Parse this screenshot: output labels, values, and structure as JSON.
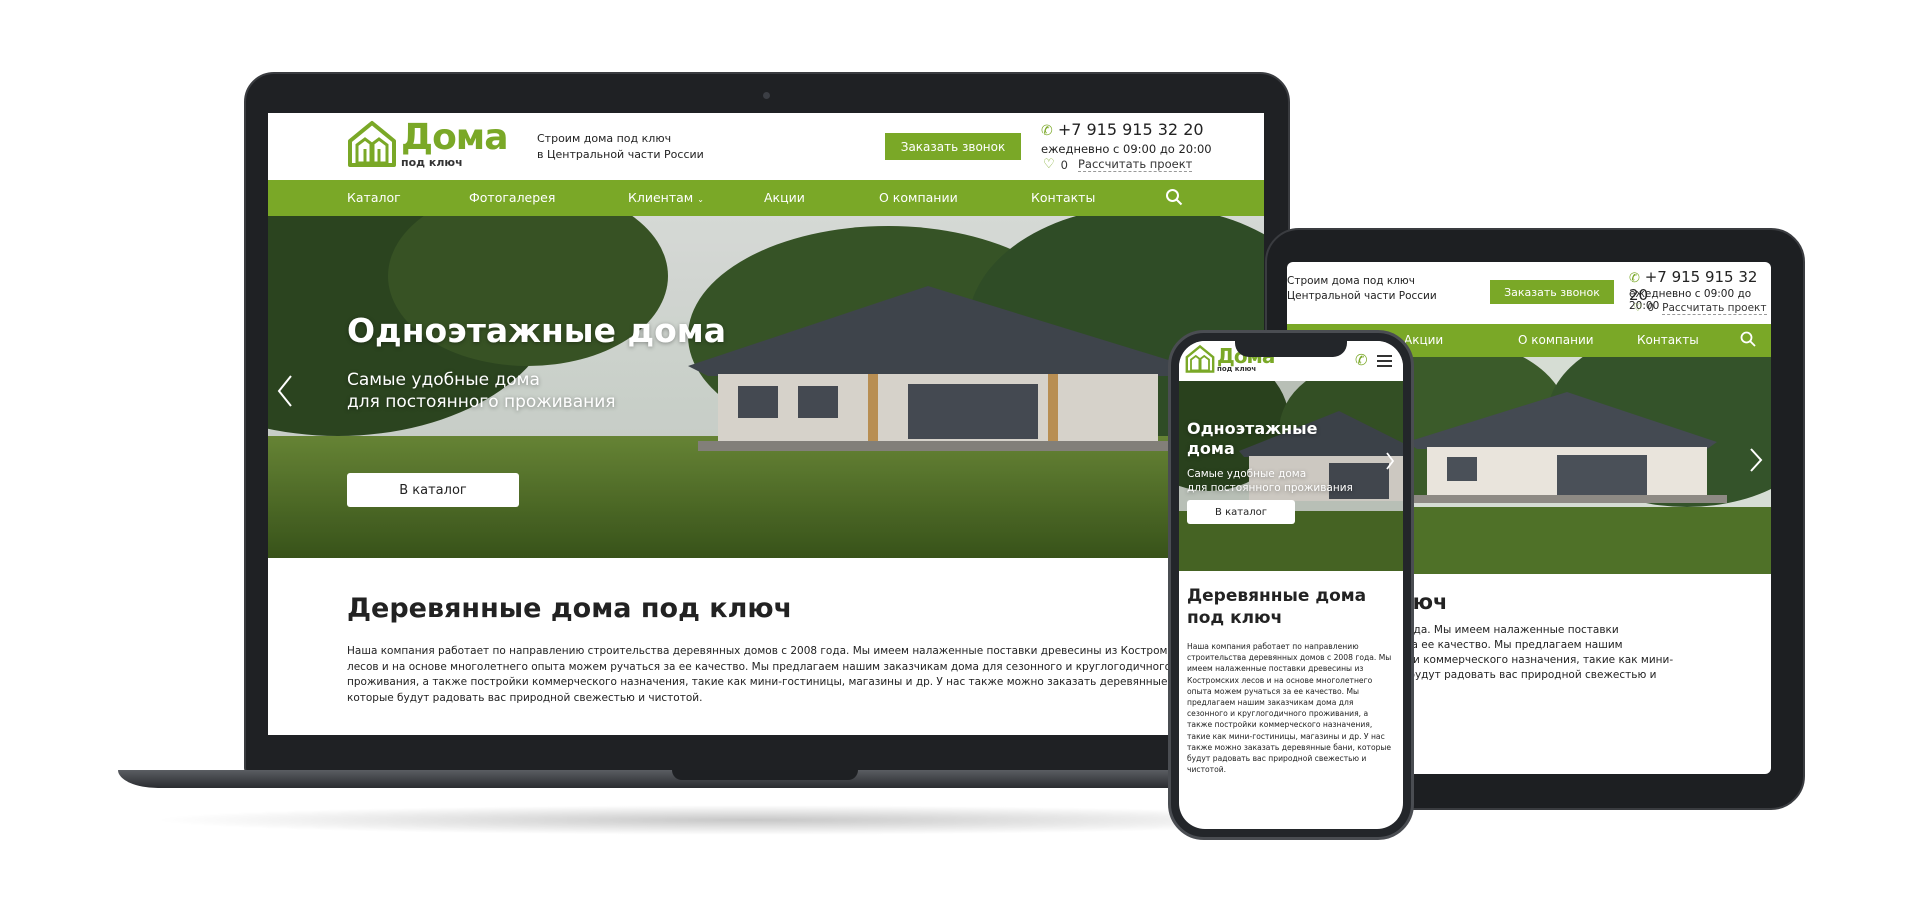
{
  "brand": {
    "logo_word": "Дома",
    "logo_sub": "под ключ",
    "tagline_line1": "Строим дома под ключ",
    "tagline_line2": "в Центральной части России"
  },
  "header": {
    "call_button": "Заказать звонок",
    "phone": "+7 915 915 32 20",
    "hours": "ежедневно с 09:00 до 20:00",
    "wishlist_count": "0",
    "calc_link": "Рассчитать проект"
  },
  "nav": {
    "items": [
      "Каталог",
      "Фотогалерея",
      "Клиентам",
      "Акции",
      "О компании",
      "Контакты"
    ]
  },
  "hero": {
    "title": "Одноэтажные дома",
    "subtitle_line1": "Самые удобные дома",
    "subtitle_line2": "для постоянного проживания",
    "button": "В каталог"
  },
  "about": {
    "title": "Деревянные дома под ключ",
    "text": "Наша компания работает по направлению строительства деревянных домов с 2008 года. Мы имеем налаженные поставки древесины из Костромских лесов и на основе многолетнего опыта можем ручаться за ее качество. Мы предлагаем нашим заказчикам дома для сезонного и круглогодичного проживания, а также постройки коммерческого назначения, такие как мини-гостиницы, магазины и др. У нас также можно заказать деревянные бани, которые будут радовать вас природной свежестью и чистотой.",
    "laptop_lines": [
      "Наша компания работает по направлению строительства деревянных домов с 2008 года. Мы имеем налаженные поставки древесины из Костромских",
      "лесов и на основе многолетнего опыта можем ручаться за ее качество. Мы предлагаем нашим заказчикам дома для сезонного и круглогодичного",
      "проживания, а также постройки коммерческого назначения, такие как мини-гостиницы, магазины и др. У нас также можно заказать деревянные бани,",
      "которые будут радовать вас природной свежестью и чистотой."
    ],
    "tablet_title": "ключ",
    "tablet_lines": [
      "янных домов с 2008 года. Мы имеем налаженные поставки",
      "ыта можем ручаться за ее качество. Мы предлагаем нашим",
      "ния, а также постройки коммерческого назначения, такие как мини-",
      "янные бани, которые будут радовать вас природной свежестью и"
    ],
    "phone_title_line1": "Деревянные дома",
    "phone_title_line2": "под ключ",
    "phone_lines": [
      "Наша компания работает по направлению",
      "строительства деревянных домов с 2008 года. Мы",
      "имеем налаженные поставки древесины из",
      "Костромских лесов и на основе многолетнего",
      "опыта можем ручаться за ее качество. Мы",
      "предлагаем нашим заказчикам дома для",
      "сезонного и круглогодичного проживания, а",
      "также постройки коммерческого назначения,",
      "такие как мини-гостиницы, магазины и др. У нас",
      "также можно заказать деревянные бани, которые",
      "будут радовать вас природной свежестью и",
      "чистотой."
    ],
    "phone_hero_title_line1": "Одноэтажные",
    "phone_hero_title_line2": "дома",
    "tablet_hero_fragment": "а",
    "tablet_tagline_line1": "Строим дома под ключ",
    "tablet_tagline_line2": "Центральной части России"
  },
  "icons": {
    "phone": "phone-icon",
    "heart": "heart-icon",
    "search": "search-icon",
    "chevron": "chevron-down-icon",
    "arrow_left": "arrow-left-icon",
    "arrow_right": "arrow-right-icon",
    "menu": "hamburger-menu-icon"
  },
  "colors": {
    "brand_green": "#7aa827",
    "dark_text": "#222222",
    "device_frame": "#1f2124"
  }
}
